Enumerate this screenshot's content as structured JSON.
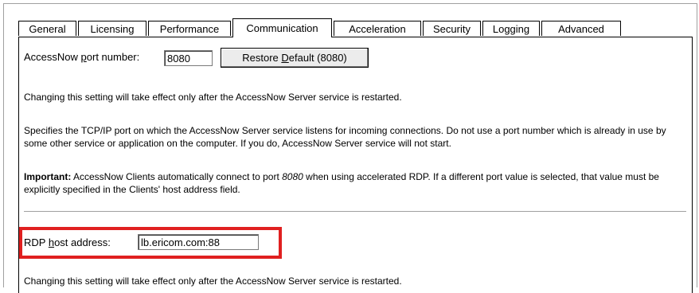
{
  "tabs": [
    {
      "label": "General"
    },
    {
      "label": "Licensing"
    },
    {
      "label": "Performance"
    },
    {
      "label": "Communication",
      "active": true
    },
    {
      "label": "Acceleration"
    },
    {
      "label": "Security"
    },
    {
      "label": "Logging"
    },
    {
      "label": "Advanced"
    }
  ],
  "port": {
    "label_prefix": "AccessNow ",
    "label_mnemonic": "p",
    "label_suffix": "ort number:",
    "value": "8080",
    "restore_prefix": "Restore ",
    "restore_mnemonic": "D",
    "restore_suffix": "efault (8080)"
  },
  "paragraphs": {
    "restart_notice": "Changing this setting will take effect only after the AccessNow Server service is restarted.",
    "port_description": "Specifies the TCP/IP port on which the AccessNow Server service listens for incoming connections. Do not use a port number which is already in use by some other service or application on the computer. If you do, AccessNow Server service will not start.",
    "important_label": "Important:",
    "important_text_1": " AccessNow Clients automatically connect to port ",
    "important_port": "8080",
    "important_text_2": " when using accelerated RDP. If a different port value is selected, that value must be explicitly specified in the Clients' host address field."
  },
  "rdp": {
    "label_prefix": "RDP ",
    "label_mnemonic": "h",
    "label_suffix": "ost address:",
    "value": "lb.ericom.com:88",
    "restart_notice": "Changing this setting will take effect only after the AccessNow Server service is restarted."
  },
  "colors": {
    "highlight": "#e02020"
  }
}
